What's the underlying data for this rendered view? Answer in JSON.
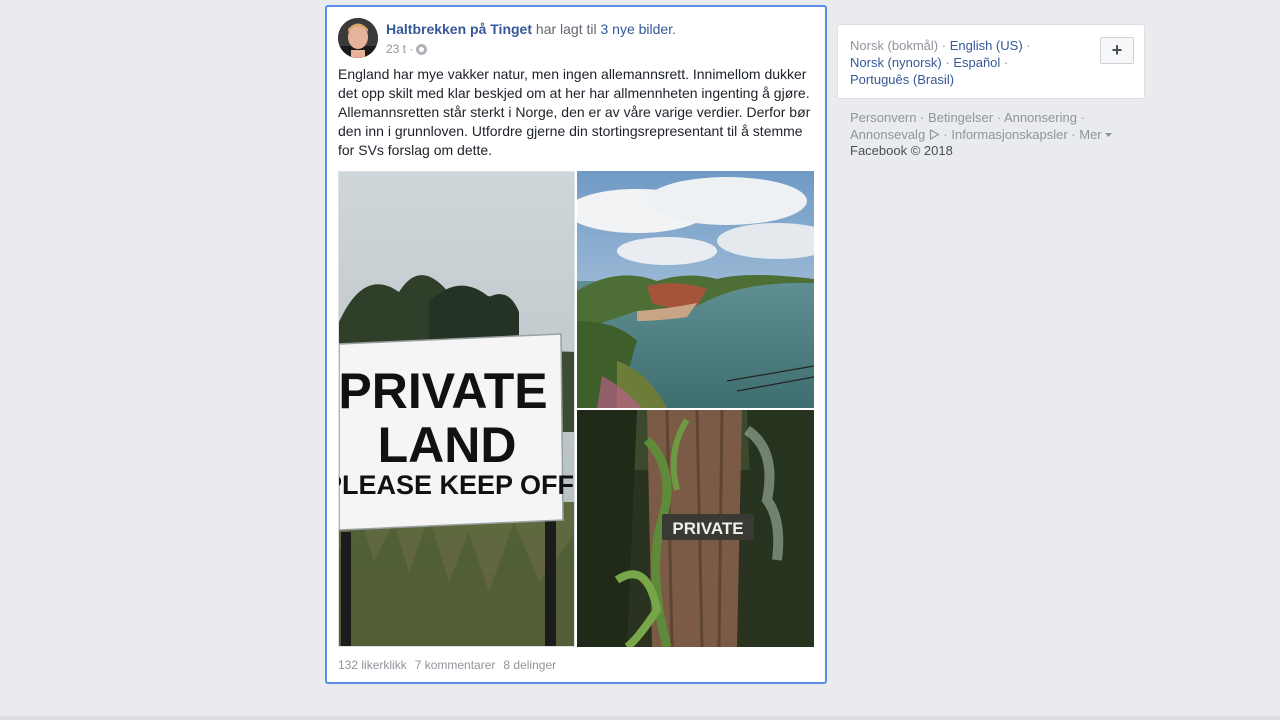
{
  "post": {
    "author": "Haltbrekken på Tinget",
    "action_text": " har lagt til ",
    "photos_link": "3 nye bilder",
    "period": ".",
    "timestamp": "23 t ·",
    "privacy_icon": "globe-icon",
    "text": "England har mye vakker natur, men ingen allemannsrett. Innimellom dukker det opp skilt med klar beskjed om at her har allmennheten ingenting å gjøre. Allemannsretten står sterkt i Norge, den er av våre varige verdier. Derfor bør den inn i grunnloven. Utfordre gjerne din stortingsrepresentant til å stemme for SVs forslag om dette.",
    "photo1_sign": [
      "PRIVATE",
      "LAND",
      "PLEASE KEEP OFF"
    ],
    "photo3_sign": "PRIVATE",
    "stats": {
      "likes": "132 likerklikk",
      "comments": "7 kommentarer",
      "shares": "8 delinger"
    }
  },
  "languages": {
    "current": "Norsk (bokmål)",
    "options": [
      "English (US)",
      "Norsk (nynorsk)",
      "Español",
      "Português (Brasil)"
    ],
    "add_label": "+"
  },
  "footer": {
    "links": [
      "Personvern",
      "Betingelser",
      "Annonsering",
      "Annonsevalg",
      "Informasjonskapsler",
      "Mer"
    ],
    "copyright": "Facebook © 2018"
  },
  "colors": {
    "link": "#365899",
    "focus_border": "#5b8ee6",
    "background": "#e9ebee"
  }
}
